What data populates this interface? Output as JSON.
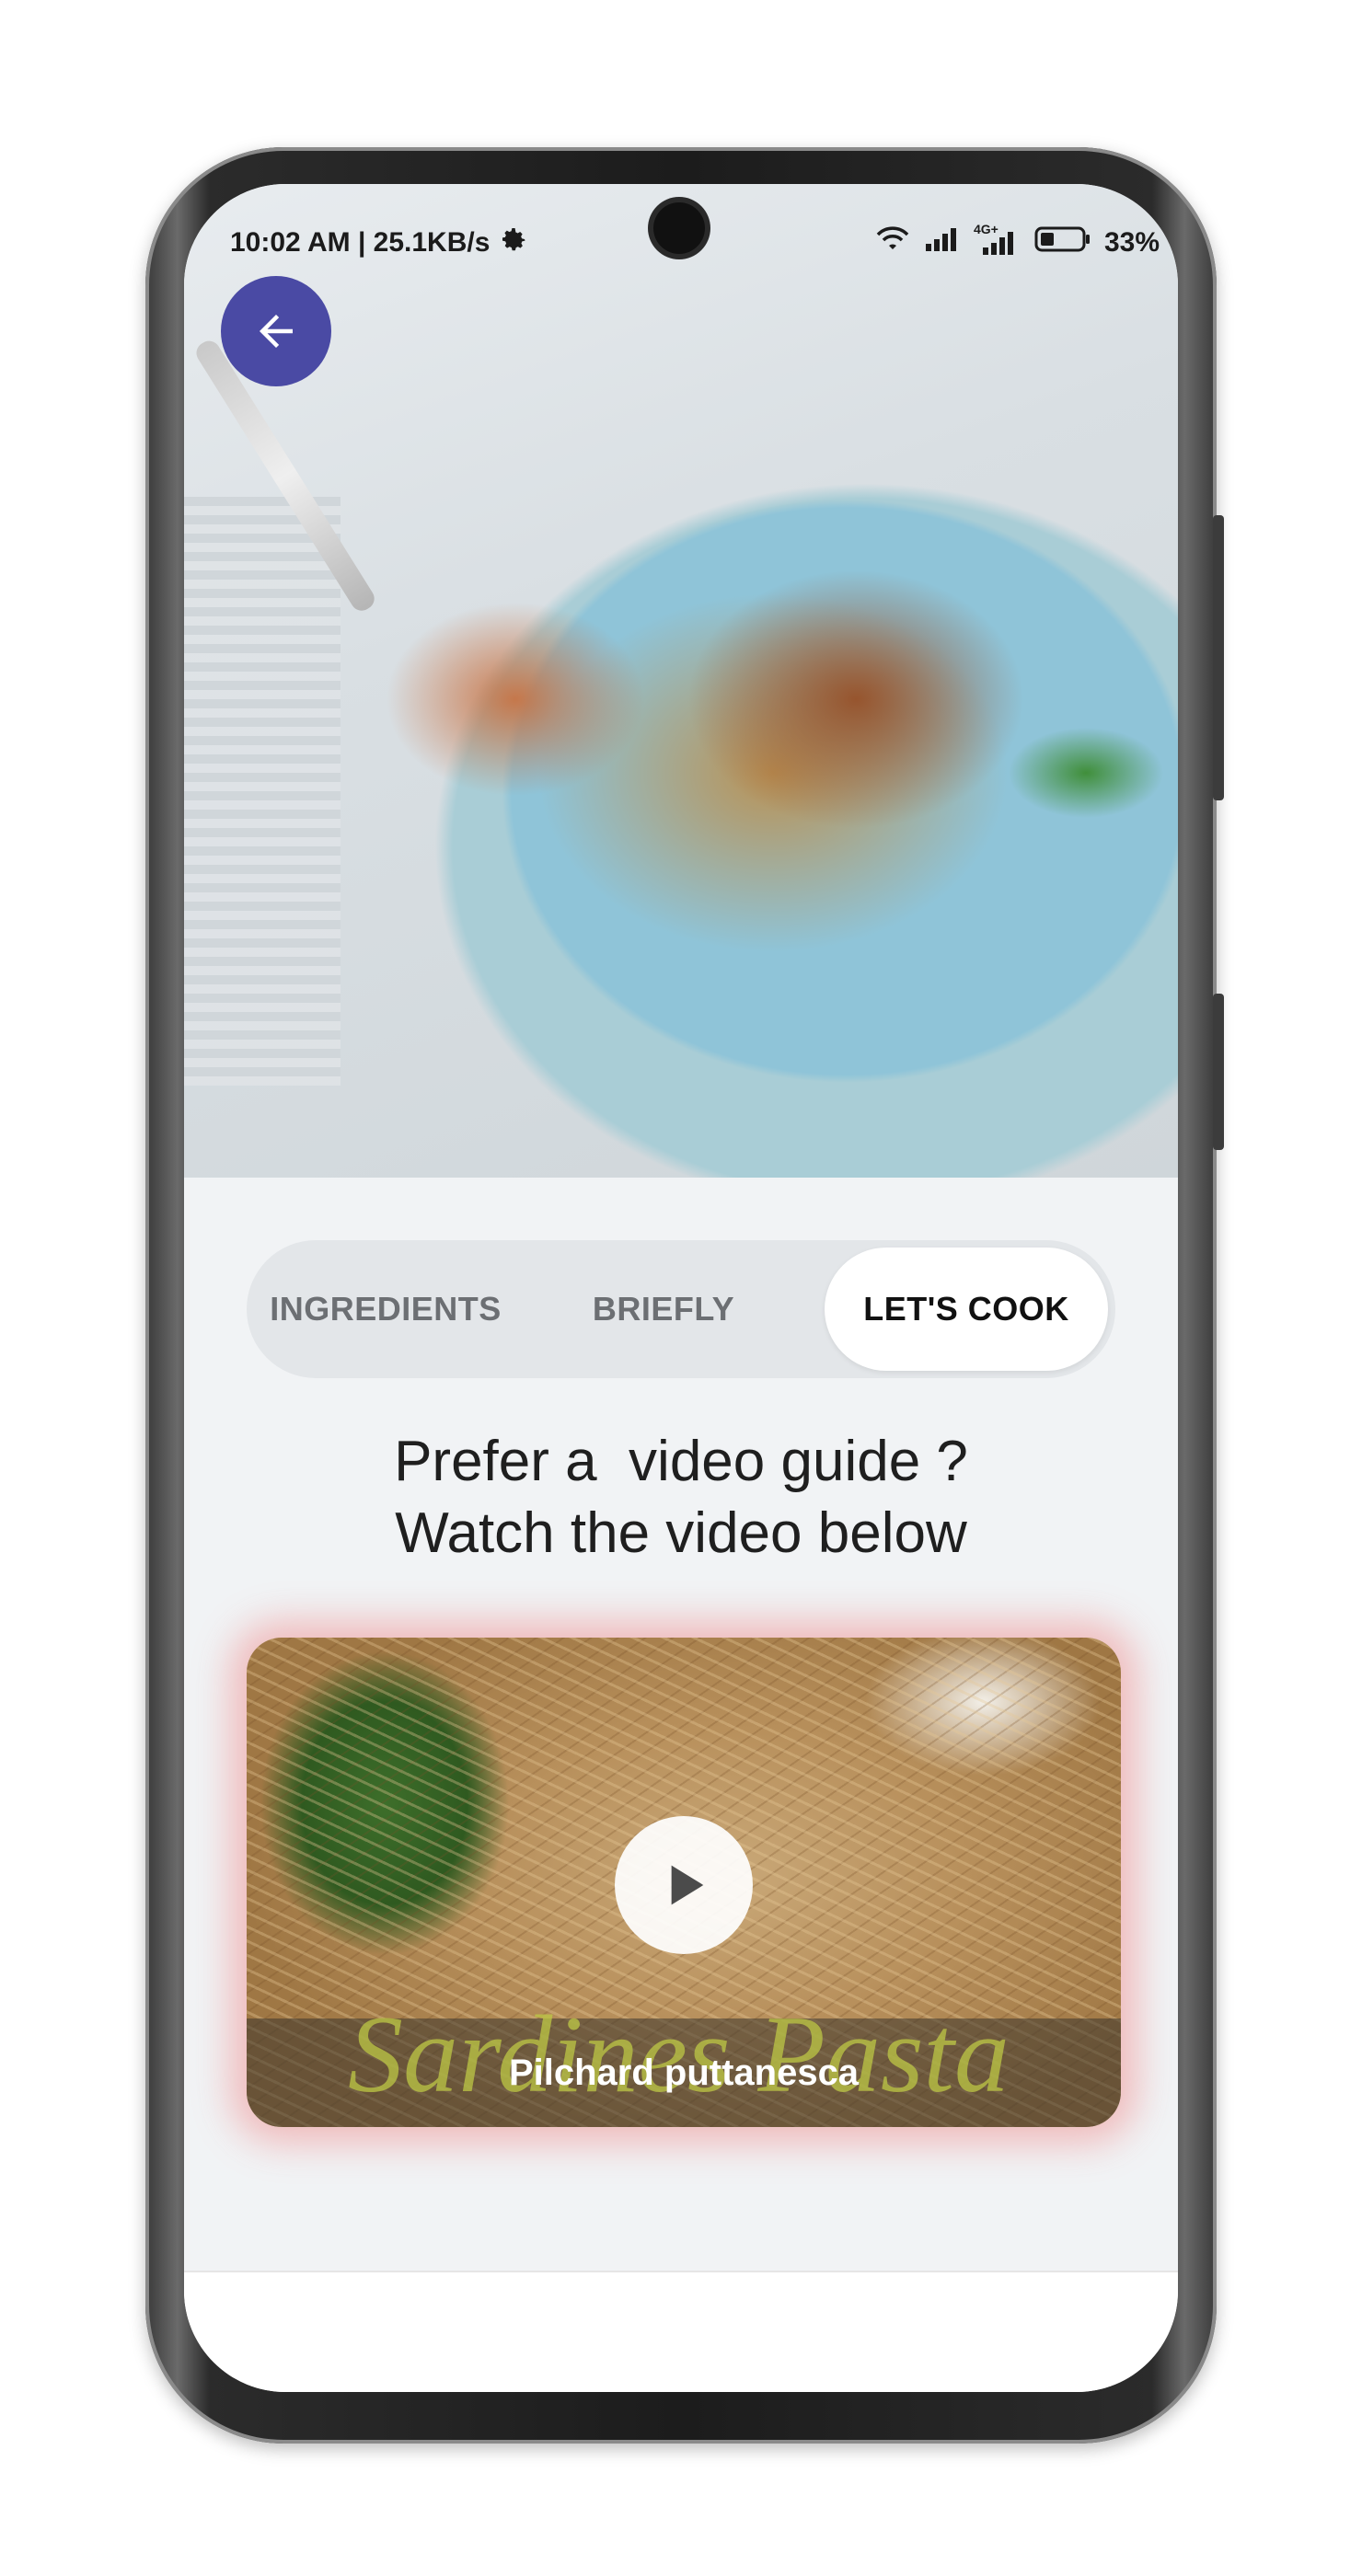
{
  "status_bar": {
    "time_speed": "10:02 AM | 25.1KB/s",
    "network_label": "4G+",
    "battery": "33%"
  },
  "hero": {
    "icon": "back-arrow-icon",
    "accent": "#4a4aa4"
  },
  "tabs": [
    {
      "label": "INGREDIENTS",
      "active": false
    },
    {
      "label": "BRIEFLY",
      "active": false
    },
    {
      "label": "LET'S COOK",
      "active": true
    }
  ],
  "headline": {
    "line1": "Prefer a  video guide ?",
    "line2": "Watch the video below"
  },
  "video": {
    "title": "Pilchard puttanesca",
    "watermark": "Sardines Pasta",
    "glow": "#f07878"
  }
}
